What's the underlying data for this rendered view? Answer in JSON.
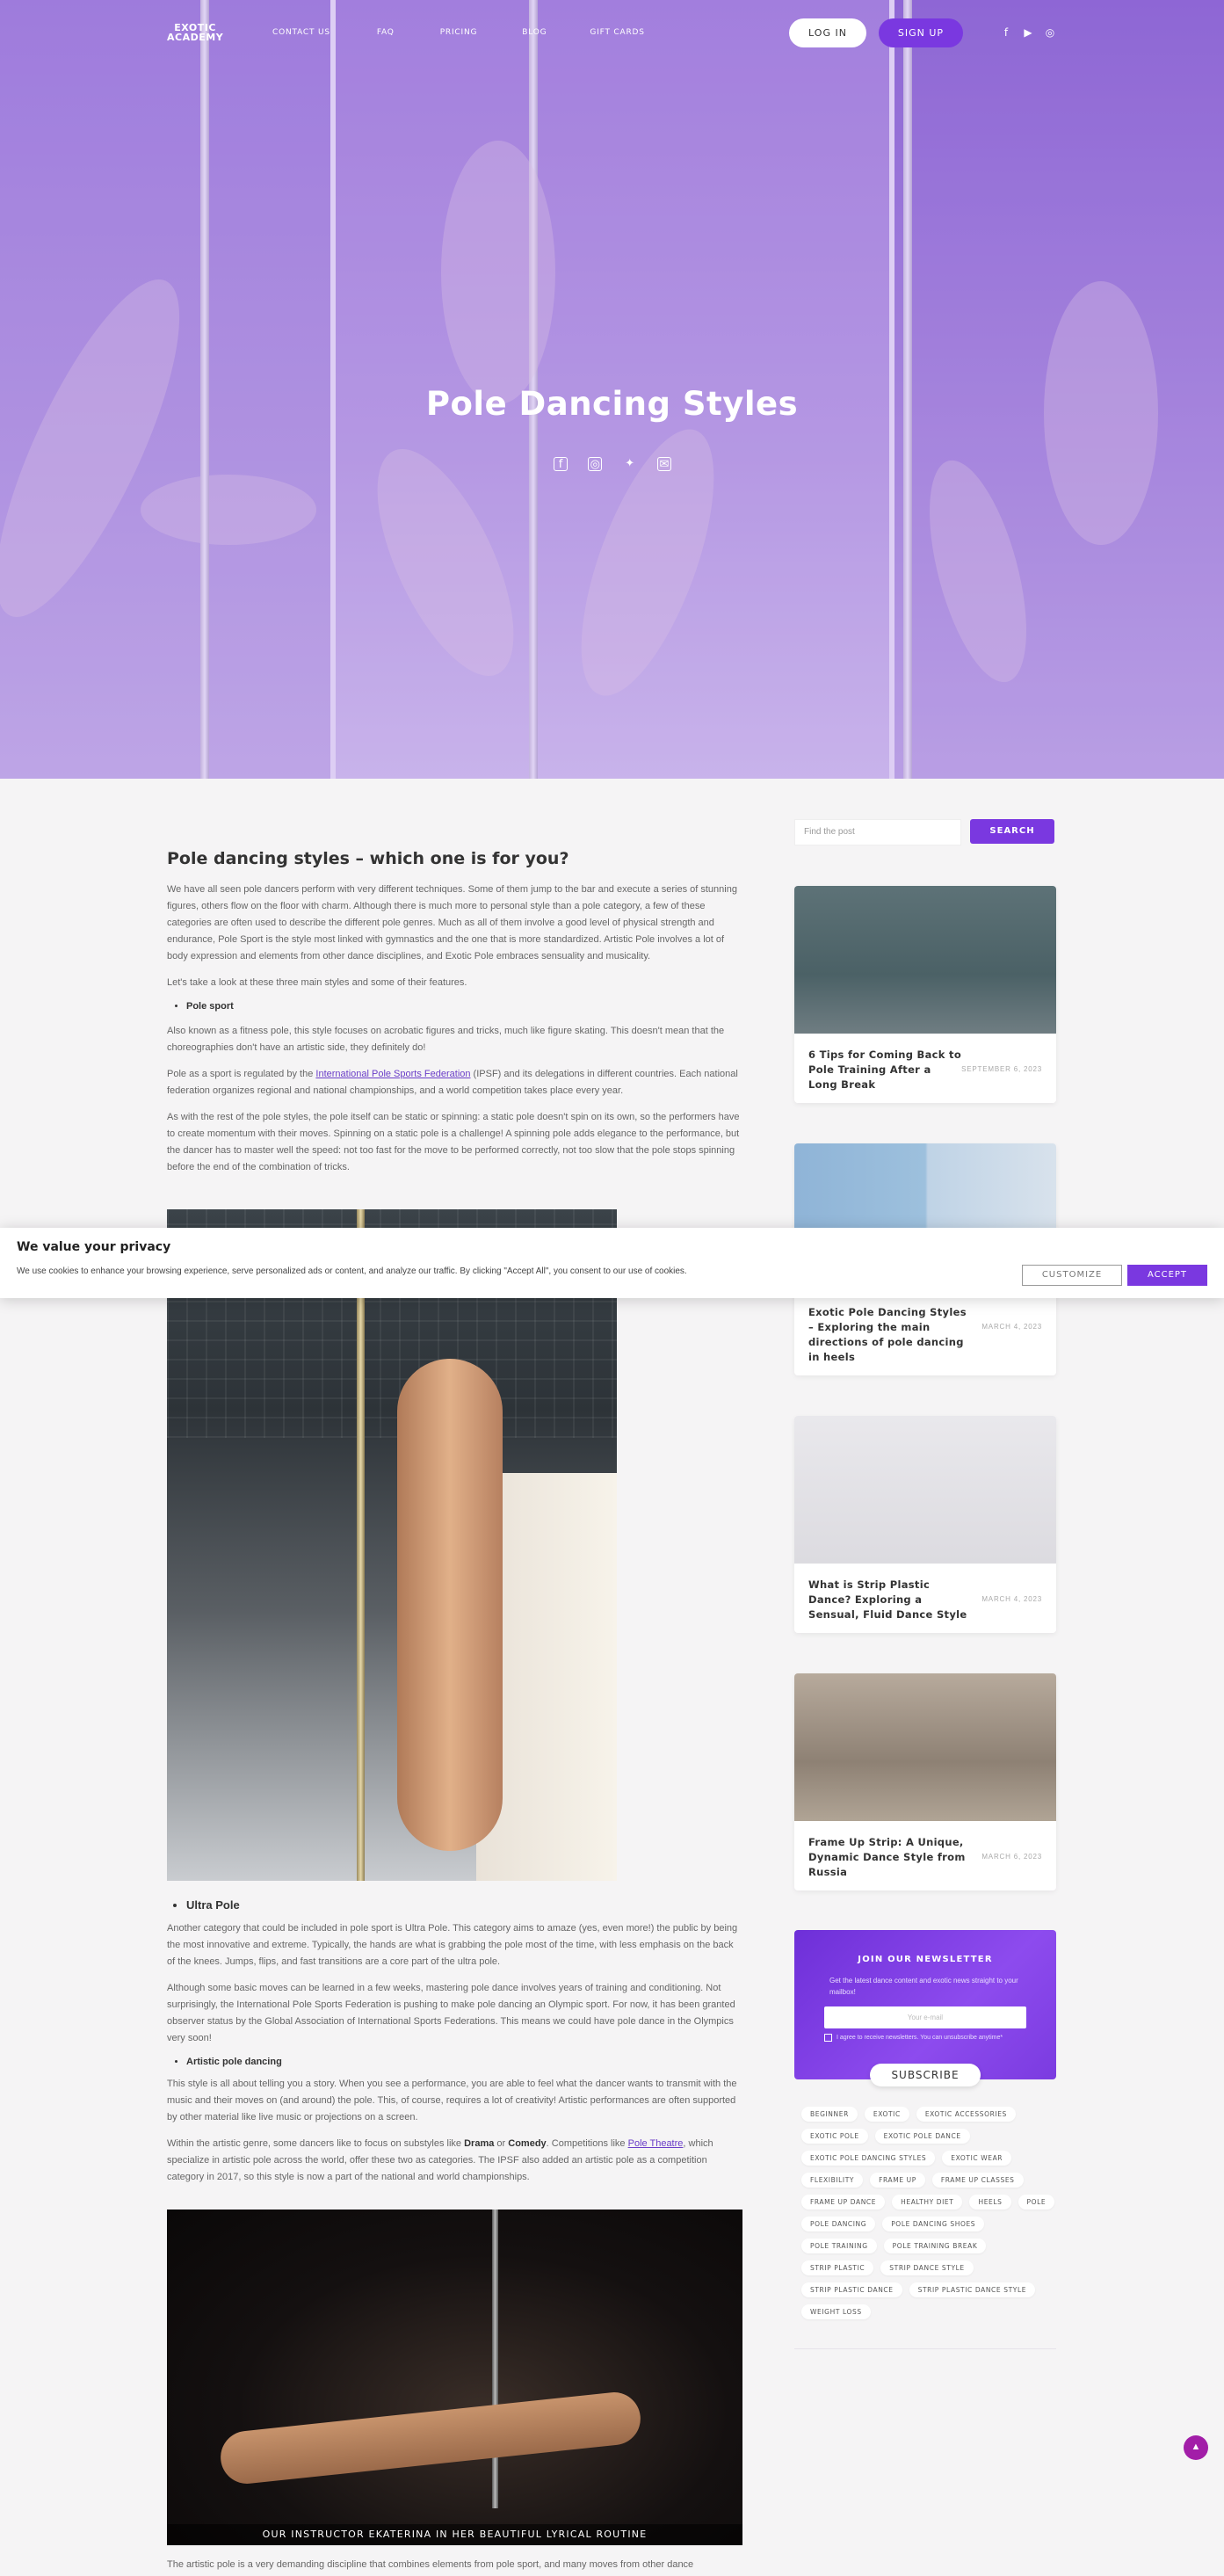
{
  "header": {
    "logo_line1": "EXOTIC",
    "logo_line2": "ACADEMY",
    "nav": [
      "CONTACT US",
      "FAQ",
      "PRICING",
      "BLOG",
      "GIFT CARDS"
    ],
    "login_label": "LOG IN",
    "signup_label": "SIGN UP",
    "social_icons": [
      "facebook-icon",
      "youtube-icon",
      "instagram-icon"
    ]
  },
  "hero": {
    "title": "Pole Dancing Styles",
    "share_icons": [
      "facebook-icon",
      "instagram-icon",
      "twitter-icon",
      "email-icon"
    ]
  },
  "article": {
    "heading": "Pole dancing styles – which one is for you?",
    "p1": "We have all seen pole dancers perform with very different techniques. Some of them jump to the bar and execute a series of stunning figures, others flow on the floor with charm.  Although there is much more to personal style than a pole category, a few of these categories are often used to describe the different pole genres. Much as all of them involve a good level of physical strength and endurance, Pole Sport is the style most linked with gymnastics and the one that is more standardized. Artistic Pole involves a lot of body expression and elements from other dance disciplines, and Exotic Pole embraces sensuality and musicality.",
    "p2": "Let's take a look at these three main styles and some of their features.",
    "bullet1": "Pole sport",
    "p3": "Also known as a fitness pole, this style focuses on acrobatic figures and tricks, much like figure skating. This doesn't mean that the choreographies don't have an artistic side, they definitely do!",
    "p4_before": "Pole as a sport is regulated by the ",
    "p4_link": "International Pole Sports Federation",
    "p4_after": " (IPSF) and its delegations in different countries. Each national federation organizes regional and national championships, and a world competition takes place every year.",
    "p5": "As with the rest of the pole styles, the pole itself can be static or spinning: a static pole doesn't spin on its own, so the performers have to create momentum with their moves. Spinning on a static pole is a challenge! A spinning pole adds elegance to the performance, but the dancer has to master well the speed: not too fast for the move to be performed correctly, not too slow that the pole stops spinning before the end of the combination of tricks.",
    "bullet2": "Ultra Pole",
    "p6": "Another category that could be included in pole sport is Ultra Pole. This category aims to amaze (yes, even more!) the public by being the most innovative and extreme. Typically, the hands are what is grabbing the pole most of the time, with less emphasis on the back of the knees. Jumps, flips, and fast transitions are a core part of the ultra pole.",
    "p7": "Although some basic moves can be learned in a few weeks, mastering pole dance involves years of training and conditioning. Not surprisingly, the International Pole Sports Federation is pushing to make pole dancing an Olympic sport. For now, it has been granted observer status by the Global Association of International Sports Federations. This means we could have pole dance in the Olympics very soon!",
    "bullet3": "Artistic pole dancing",
    "p8": "This style is all about telling you a story. When you see a performance, you are able to feel what the dancer wants to transmit with the music and their moves on (and around) the pole. This, of course, requires a lot of creativity! Artistic performances are often supported by other material like live music or projections on a screen.",
    "p9_before": "Within the artistic genre, some dancers like to focus on substyles like ",
    "p9_drama": "Drama",
    "p9_or": " or ",
    "p9_comedy": "Comedy",
    "p9_mid": ". Competitions like ",
    "p9_link": "Pole Theatre",
    "p9_after": ", which specialize in artistic pole across the world, offer these two as categories. The IPSF also added an artistic pole as a competition category in 2017, so this style is now a part of the national and world championships.",
    "photo2_caption": "OUR INSTRUCTOR EKATERINA IN HER BEAUTIFUL LYRICAL ROUTINE",
    "p10": "The artistic pole is a very demanding discipline that combines elements from pole sport, and many moves from other dance"
  },
  "sidebar": {
    "search_placeholder": "Find the post",
    "search_button": "SEARCH",
    "posts": [
      {
        "title": "6 Tips for Coming Back to Pole Training After a Long Break",
        "date": "SEPTEMBER 6, 2023"
      },
      {
        "title": "Exotic Pole Dancing Styles – Exploring the main directions of pole dancing in heels",
        "date": "MARCH 4, 2023"
      },
      {
        "title": "What is Strip Plastic Dance? Exploring a Sensual, Fluid Dance Style",
        "date": "MARCH 4, 2023"
      },
      {
        "title": "Frame Up Strip: A Unique, Dynamic Dance Style from Russia",
        "date": "MARCH 6, 2023"
      }
    ],
    "newsletter": {
      "title": "JOIN OUR NEWSLETTER",
      "subtitle": "Get the latest dance content and exotic news straight to your mailbox!",
      "email_placeholder": "Your e-mail",
      "consent": "I agree to receive newsletters. You can unsubscribe anytime*",
      "button": "SUBSCRIBE"
    },
    "tags": [
      "BEGINNER",
      "EXOTIC",
      "EXOTIC ACCESSORIES",
      "EXOTIC POLE",
      "EXOTIC POLE DANCE",
      "EXOTIC POLE DANCING STYLES",
      "EXOTIC WEAR",
      "FLEXIBILITY",
      "FRAME UP",
      "FRAME UP CLASSES",
      "FRAME UP DANCE",
      "HEALTHY DIET",
      "HEELS",
      "POLE",
      "POLE DANCING",
      "POLE DANCING SHOES",
      "POLE TRAINING",
      "POLE TRAINING BREAK",
      "STRIP PLASTIC",
      "STRIP DANCE STYLE",
      "STRIP PLASTIC DANCE",
      "STRIP PLASTIC DANCE STYLE",
      "WEIGHT LOSS"
    ]
  },
  "cookie": {
    "title": "We value your privacy",
    "message": "We use cookies to enhance your browsing experience, serve personalized ads or content, and analyze our traffic. By clicking \"Accept All\", you consent to our use of cookies.",
    "customize": "CUSTOMIZE",
    "accept": "ACCEPT"
  },
  "colors": {
    "accent": "#7a38e0",
    "hero_tint": "#a887dd",
    "to_top": "#a21ea8"
  }
}
